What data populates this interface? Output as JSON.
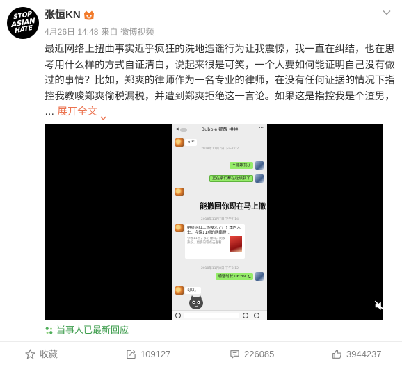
{
  "post": {
    "avatar": {
      "logo_lines": [
        "STOP",
        "ASIAN",
        "HATE"
      ]
    },
    "author_name": "张恒KN",
    "author_badge_icon": "vip-member-badge-icon",
    "menu_icon": "chevron-down-icon",
    "timestamp": "4月26日 14:48",
    "source_prefix": "来自",
    "source_name": "微博视频",
    "text_lines": [
      "最近网络上扭曲事实近乎疯狂的洗地造谣行为让我震惊，我一直在纠结，也在思",
      "考用什么样的方式自证清白，说起来很是可笑，一个人要如何能证明自己没有做",
      "过的事情？比如，郑爽的律师作为一名专业的律师，在没有任何证据的情况下指",
      "控我教唆郑爽偷税漏税，并遭到郑爽拒绝这一言论。如果这是指控我是个渣男，"
    ],
    "ellipsis": "…",
    "expand_label": "展开全文",
    "expand_icon": "chevron-down-icon"
  },
  "video": {
    "mute_icon": "volume-muted-icon",
    "subtitle": "能撤回你现在马上撤",
    "chat": {
      "back_label": "<",
      "title": "Bubble 都醒 拱拱",
      "more_label": "···",
      "timestamps": [
        "2018年11月7日 下午7:02",
        "2018年11月7日 下午7:14",
        "2018年11月8日 下午3:12"
      ],
      "incoming_1": "< *'",
      "outgoing_1": "不能跟我了",
      "outgoing_2": "正在拿们都在吃讽我了",
      "link_card": {
        "title": "明星网红上热搜光了？！本内人士：今晚11点的网络投…",
        "description": "今晚11点，多方爆料，网友热议，更多内容点击查看…"
      },
      "call_record": {
        "text": "通话时长 06:39",
        "icon": "phone-icon"
      },
      "incoming_2": "可以。",
      "sticker_icon": "cartoon-sticker-icon"
    }
  },
  "tag": {
    "label": "当事人已最新回应",
    "icon": "sparkle-icon",
    "color": "#3e9d4d"
  },
  "actions": [
    {
      "label": "收藏",
      "icon": "star-icon"
    },
    {
      "label": "109127",
      "icon": "share-icon"
    },
    {
      "label": "226085",
      "icon": "comment-icon"
    },
    {
      "label": "3944237",
      "icon": "like-icon"
    }
  ],
  "colors": {
    "link_orange": "#eb7350",
    "meta_gray": "#939393",
    "action_gray": "#808080",
    "chat_bubble_green": "#95ec69",
    "chat_background": "#ededed",
    "video_background": "#000000"
  }
}
